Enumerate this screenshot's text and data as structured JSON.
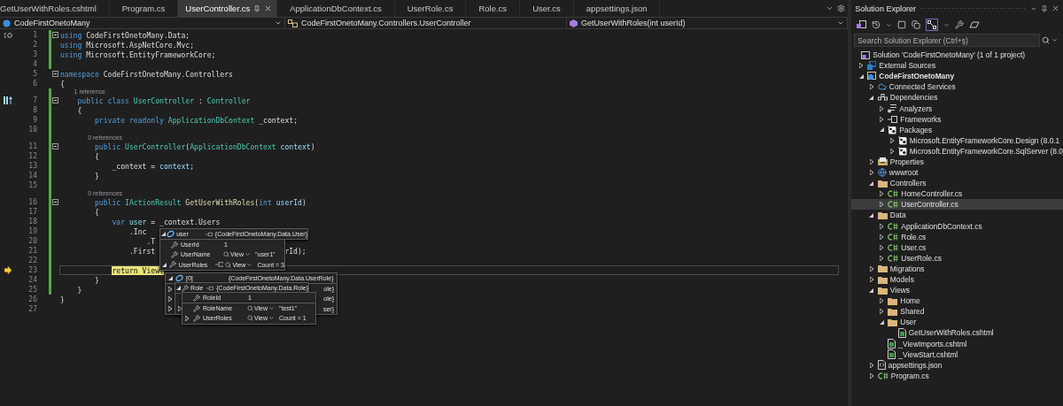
{
  "editor": {
    "tabs": [
      {
        "label": "GetUserWithRoles.cshtml",
        "selected": false
      },
      {
        "label": "Program.cs",
        "selected": false
      },
      {
        "label": "UserController.cs",
        "selected": true
      },
      {
        "label": "ApplicationDbContext.cs",
        "selected": false
      },
      {
        "label": "UserRole.cs",
        "selected": false
      },
      {
        "label": "Role.cs",
        "selected": false
      },
      {
        "label": "User.cs",
        "selected": false
      },
      {
        "label": "appsettings.json",
        "selected": false
      }
    ],
    "nav": {
      "project": "CodeFirstOnetoMany",
      "type": "CodeFirstOnetoMany.Controllers.UserController",
      "member": "GetUserWithRoles(int userId)"
    },
    "lines": [
      {
        "number": "1",
        "kind": "quick-action",
        "fold": true,
        "changed": true,
        "current": false,
        "tokens": [
          {
            "text": "using",
            "kind": "kw"
          },
          {
            "text": " CodeFirstOnetoMany.Data;",
            "kind": "p"
          }
        ]
      },
      {
        "number": "2",
        "kind": "plain",
        "fold": false,
        "changed": true,
        "current": false,
        "tokens": [
          {
            "text": "using",
            "kind": "kw"
          },
          {
            "text": " Microsoft.AspNetCore.Mvc;",
            "kind": "p"
          }
        ]
      },
      {
        "number": "3",
        "kind": "plain",
        "fold": false,
        "changed": true,
        "current": false,
        "tokens": [
          {
            "text": "using",
            "kind": "kw"
          },
          {
            "text": " Microsoft.EntityFrameworkCore;",
            "kind": "p"
          }
        ]
      },
      {
        "number": "4",
        "kind": "plain",
        "fold": false,
        "changed": true,
        "current": false
      },
      {
        "number": "5",
        "kind": "plain",
        "fold": true,
        "changed": false,
        "current": false,
        "tokens": [
          {
            "text": "namespace",
            "kind": "kw"
          },
          {
            "text": " CodeFirstOnetoMany.Controllers",
            "kind": "p"
          }
        ]
      },
      {
        "number": "6",
        "kind": "plain",
        "fold": false,
        "changed": false,
        "current": false,
        "tokens": [
          {
            "text": "{",
            "kind": "p"
          }
        ]
      },
      {
        "number": "7",
        "kind": "hierarchy",
        "lens": "1 reference",
        "fold": true,
        "changed": true,
        "current": false,
        "tokens": [
          {
            "text": "    public class",
            "kind": "kw"
          },
          {
            "text": " UserController",
            "kind": "type"
          },
          {
            "text": " : ",
            "kind": "p"
          },
          {
            "text": "Controller",
            "kind": "type"
          }
        ]
      },
      {
        "number": "8",
        "kind": "plain",
        "fold": false,
        "changed": true,
        "current": false,
        "tokens": [
          {
            "text": "    {",
            "kind": "p"
          }
        ]
      },
      {
        "number": "9",
        "kind": "plain",
        "fold": false,
        "changed": true,
        "current": false,
        "tokens": [
          {
            "text": "        private readonly",
            "kind": "kw"
          },
          {
            "text": " ApplicationDbContext",
            "kind": "type"
          },
          {
            "text": " _context;",
            "kind": "p"
          }
        ]
      },
      {
        "number": "10",
        "kind": "plain",
        "fold": false,
        "changed": true,
        "current": false
      },
      {
        "number": "11",
        "kind": "plain",
        "lens": "0 references",
        "fold": true,
        "changed": true,
        "current": false,
        "tokens": [
          {
            "text": "        public",
            "kind": "kw"
          },
          {
            "text": " UserController",
            "kind": "type"
          },
          {
            "text": "(",
            "kind": "p"
          },
          {
            "text": "ApplicationDbContext",
            "kind": "type"
          },
          {
            "text": " context",
            "kind": "param"
          },
          {
            "text": ")",
            "kind": "p"
          }
        ]
      },
      {
        "number": "12",
        "kind": "plain",
        "fold": false,
        "changed": true,
        "current": false,
        "tokens": [
          {
            "text": "        {",
            "kind": "p"
          }
        ]
      },
      {
        "number": "13",
        "kind": "plain",
        "fold": false,
        "changed": true,
        "current": false,
        "tokens": [
          {
            "text": "            _context = ",
            "kind": "p"
          },
          {
            "text": "context",
            "kind": "param"
          },
          {
            "text": ";",
            "kind": "p"
          }
        ]
      },
      {
        "number": "14",
        "kind": "plain",
        "fold": false,
        "changed": true,
        "current": false,
        "tokens": [
          {
            "text": "        }",
            "kind": "p"
          }
        ]
      },
      {
        "number": "15",
        "kind": "plain",
        "fold": false,
        "changed": true,
        "current": false
      },
      {
        "number": "16",
        "kind": "plain",
        "lens": "0 references",
        "fold": true,
        "changed": true,
        "current": false,
        "tokens": [
          {
            "text": "        public",
            "kind": "kw"
          },
          {
            "text": " IActionResult",
            "kind": "type"
          },
          {
            "text": " GetUserWithRoles",
            "kind": "method"
          },
          {
            "text": "(",
            "kind": "p"
          },
          {
            "text": "int",
            "kind": "kw"
          },
          {
            "text": " userId",
            "kind": "param"
          },
          {
            "text": ")",
            "kind": "p"
          }
        ]
      },
      {
        "number": "17",
        "kind": "plain",
        "fold": false,
        "changed": true,
        "current": false,
        "tokens": [
          {
            "text": "        {",
            "kind": "p"
          }
        ]
      },
      {
        "number": "18",
        "kind": "plain",
        "fold": false,
        "changed": true,
        "current": false,
        "tokens": [
          {
            "text": "            var",
            "kind": "kw"
          },
          {
            "text": " user",
            "kind": "param"
          },
          {
            "text": " = _context.Users",
            "kind": "p"
          }
        ]
      },
      {
        "number": "19",
        "kind": "plain",
        "fold": false,
        "changed": true,
        "current": false,
        "tokens": [
          {
            "text": "                .Inc",
            "kind": "p"
          }
        ]
      },
      {
        "number": "20",
        "kind": "plain",
        "fold": false,
        "changed": true,
        "current": false,
        "tokens": [
          {
            "text": "                    .T",
            "kind": "p"
          }
        ]
      },
      {
        "number": "21",
        "kind": "plain",
        "fold": false,
        "changed": true,
        "current": false,
        "tokens": [
          {
            "text": "                .First",
            "kind": "p"
          }
        ],
        "tail": "rId);"
      },
      {
        "number": "22",
        "kind": "plain",
        "fold": false,
        "changed": true,
        "current": false
      },
      {
        "number": "23",
        "kind": "execution",
        "fold": false,
        "changed": true,
        "current": true,
        "tokens": [
          {
            "text": "            return View(",
            "kind": "stmt"
          }
        ]
      },
      {
        "number": "24",
        "kind": "plain",
        "fold": false,
        "changed": true,
        "current": false,
        "tokens": [
          {
            "text": "        }",
            "kind": "p"
          }
        ]
      },
      {
        "number": "25",
        "kind": "plain",
        "fold": false,
        "changed": true,
        "current": false,
        "tokens": [
          {
            "text": "    }",
            "kind": "p"
          }
        ]
      },
      {
        "number": "26",
        "kind": "plain",
        "fold": false,
        "changed": false,
        "current": false,
        "tokens": [
          {
            "text": "}",
            "kind": "p"
          }
        ]
      },
      {
        "number": "27",
        "kind": "plain",
        "fold": false,
        "changed": false,
        "current": false
      }
    ],
    "datatips": [
      {
        "rows": [
          {
            "kind": "object",
            "expanded": true,
            "name": "user",
            "pin": true,
            "value": "{CodeFirstOnetoMany.Data.User}"
          },
          {
            "kind": "property",
            "name": "UserId",
            "pin": false,
            "value": "1"
          },
          {
            "kind": "property",
            "name": "UserName",
            "pin": false,
            "view": "View",
            "value": "\"user1\""
          },
          {
            "kind": "property",
            "expanded": true,
            "name": "UserRoles",
            "pin": true,
            "view": "View",
            "value": "Count = 3"
          }
        ]
      },
      {
        "rows": [
          {
            "kind": "object",
            "expanded": true,
            "name": "[0]",
            "pin": false,
            "value": "{CodeFirstOnetoMany.Data.UserRole}"
          },
          {
            "kind": "partial",
            "expanded": false,
            "value": "ole}"
          },
          {
            "kind": "partial",
            "expanded": false,
            "value": "ole}"
          },
          {
            "kind": "partial",
            "expanded": false,
            "value": "ser}"
          }
        ]
      },
      {
        "rows": [
          {
            "kind": "property",
            "expanded": true,
            "name": "Role",
            "pin": true,
            "value": "{CodeFirstOnetoMany.Data.Role}"
          },
          {
            "kind": "partial"
          },
          {
            "kind": "partial",
            "expanded": false
          }
        ]
      },
      {
        "rows": [
          {
            "kind": "property",
            "name": "RoleId",
            "pin": false,
            "value": "1"
          },
          {
            "kind": "property",
            "name": "RoleName",
            "pin": false,
            "view": "View",
            "value": "\"test1\""
          },
          {
            "kind": "property",
            "expanded": false,
            "name": "UserRoles",
            "pin": false,
            "view": "View",
            "value": "Count = 1"
          }
        ]
      }
    ]
  },
  "solution_explorer": {
    "title": "Solution Explorer",
    "search": {
      "placeholder": "Search Solution Explorer (Ctrl+ş)"
    },
    "tree": [
      {
        "label": "Solution 'CodeFirstOnetoMany' (1 of 1 project)",
        "kind": "solution",
        "selected": false,
        "children": [
          {
            "label": "External Sources",
            "kind": "external",
            "expanded": false,
            "selected": false
          },
          {
            "label": "CodeFirstOnetoMany",
            "kind": "project",
            "expanded": true,
            "selected": false,
            "children": [
              {
                "label": "Connected Services",
                "kind": "connected",
                "expanded": false,
                "selected": false
              },
              {
                "label": "Dependencies",
                "kind": "dependencies",
                "expanded": true,
                "selected": false,
                "children": [
                  {
                    "label": "Analyzers",
                    "kind": "analyzers",
                    "expanded": false,
                    "selected": false
                  },
                  {
                    "label": "Frameworks",
                    "kind": "frameworks",
                    "expanded": false,
                    "selected": false
                  },
                  {
                    "label": "Packages",
                    "kind": "package",
                    "expanded": true,
                    "selected": false,
                    "children": [
                      {
                        "label": "Microsoft.EntityFrameworkCore.Design (8.0.1",
                        "kind": "package",
                        "expanded": false,
                        "selected": false
                      },
                      {
                        "label": "Microsoft.EntityFrameworkCore.SqlServer (8.0",
                        "kind": "package",
                        "expanded": false,
                        "selected": false
                      }
                    ]
                  }
                ]
              },
              {
                "label": "Properties",
                "kind": "properties",
                "expanded": false,
                "selected": false
              },
              {
                "label": "wwwroot",
                "kind": "web",
                "expanded": false,
                "selected": false
              },
              {
                "label": "Controllers",
                "kind": "folder",
                "expanded": true,
                "selected": false,
                "children": [
                  {
                    "label": "HomeController.cs",
                    "kind": "csharp",
                    "expanded": false,
                    "selected": false
                  },
                  {
                    "label": "UserController.cs",
                    "kind": "csharp",
                    "expanded": false,
                    "selected": true
                  }
                ]
              },
              {
                "label": "Data",
                "kind": "folder",
                "expanded": true,
                "selected": false,
                "children": [
                  {
                    "label": "ApplicationDbContext.cs",
                    "kind": "csharp",
                    "expanded": false,
                    "selected": false
                  },
                  {
                    "label": "Role.cs",
                    "kind": "csharp",
                    "expanded": false,
                    "selected": false
                  },
                  {
                    "label": "User.cs",
                    "kind": "csharp",
                    "expanded": false,
                    "selected": false
                  },
                  {
                    "label": "UserRole.cs",
                    "kind": "csharp",
                    "expanded": false,
                    "selected": false
                  }
                ]
              },
              {
                "label": "Migrations",
                "kind": "folder",
                "expanded": false,
                "selected": false
              },
              {
                "label": "Models",
                "kind": "folder",
                "expanded": false,
                "selected": false
              },
              {
                "label": "Views",
                "kind": "folder",
                "expanded": true,
                "selected": false,
                "children": [
                  {
                    "label": "Home",
                    "kind": "folder",
                    "expanded": false,
                    "selected": false
                  },
                  {
                    "label": "Shared",
                    "kind": "folder",
                    "expanded": false,
                    "selected": false
                  },
                  {
                    "label": "User",
                    "kind": "folder",
                    "expanded": true,
                    "selected": false,
                    "children": [
                      {
                        "label": "GetUserWithRoles.cshtml",
                        "kind": "razor",
                        "selected": false
                      }
                    ]
                  },
                  {
                    "label": "_ViewImports.cshtml",
                    "kind": "razor",
                    "selected": false
                  },
                  {
                    "label": "_ViewStart.cshtml",
                    "kind": "razor",
                    "selected": false
                  }
                ]
              },
              {
                "label": "appsettings.json",
                "kind": "json",
                "expanded": false,
                "selected": false
              },
              {
                "label": "Program.cs",
                "kind": "csharp",
                "expanded": false,
                "selected": false
              }
            ]
          }
        ]
      }
    ]
  }
}
